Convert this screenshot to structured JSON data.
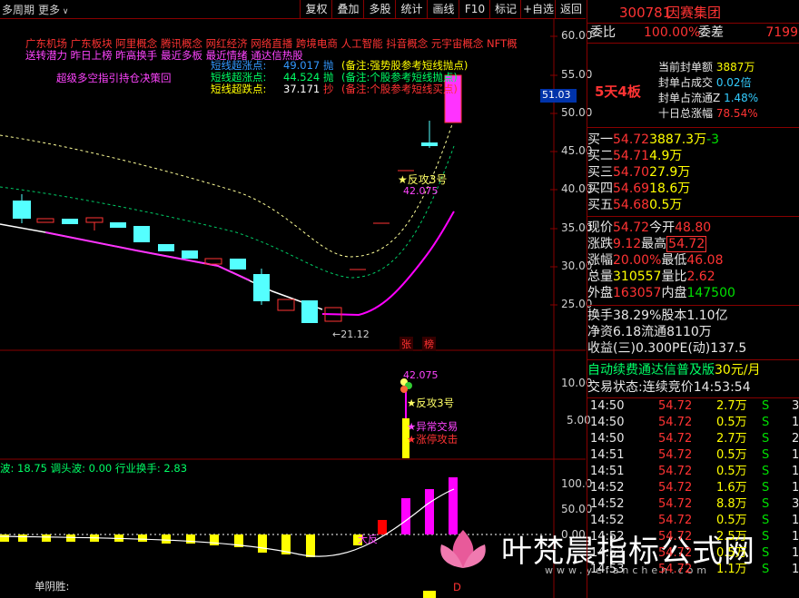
{
  "toolbar": {
    "period": "多周期",
    "more": "更多",
    "buttons": [
      "复权",
      "叠加",
      "多股",
      "统计",
      "画线",
      "F10",
      "标记",
      "+自选",
      "返回"
    ]
  },
  "chart": {
    "y_axis": [
      "60.00",
      "55.00",
      "50.00",
      "45.00",
      "40.00",
      "35.00",
      "30.00",
      "25.00"
    ],
    "price_tag": "51.03",
    "concepts_line1": "广东机场 广东板块 阿里概念 腾讯概念 网红经济 网络直播 跨境电商 人工智能 抖音概念 元宇宙概念 NFT概",
    "concepts_line2": "送转潜力 昨日上榜 昨高换手 最近多板 最近情绪 通达信热股",
    "strategy_label": "超级多空指引持仓决策回",
    "legend_rows": [
      {
        "name": "短线超涨点:",
        "value": "49.017",
        "action": "抛",
        "note": "(备注:强势股参考短线抛点)"
      },
      {
        "name": "短线超涨点:",
        "value": "44.524",
        "action": "抛",
        "note": "(备注:个股参考短线抛点)"
      },
      {
        "name": "短线超跌点:",
        "value": "37.171",
        "action": "抄",
        "note": "(备注:个股参考短线买点)"
      }
    ],
    "fangong_label": "★反攻3号",
    "fangong_value": "42.075",
    "low_label": "←21.12",
    "tag_zhang": "张",
    "tag_bang": "榜"
  },
  "sub1": {
    "y_axis": [
      "10.00",
      "5.00"
    ],
    "value_label": "42.075",
    "markers": [
      "★反攻3号",
      "★异常交易",
      "★涨停攻击"
    ]
  },
  "sub2": {
    "indicator_text": "波: 18.75  调头波: 0.00  行业换手: 2.83",
    "y_axis": [
      "100.0",
      "50.00",
      "0.00"
    ],
    "arrow_label": "大反",
    "bottom_label": "单阴胜:",
    "d_label": "D"
  },
  "watermark": {
    "title": "叶梵晨指标公式网",
    "url": "www.yefanchen.com"
  },
  "right": {
    "code": "300781",
    "name": "因赛集团",
    "weibi_label": "委比",
    "weibi_value": "100.00%",
    "weicha_label": "委差",
    "weicha_value": "7199",
    "board_tag": "5天4板",
    "seal_rows": [
      {
        "label": "当前封单额",
        "value": "3887万"
      },
      {
        "label": "封单占成交",
        "value": "0.02倍"
      },
      {
        "label": "封单占流通Z",
        "value": "1.48%"
      },
      {
        "label": "十日总涨幅",
        "value": "78.54%"
      }
    ],
    "bids": [
      {
        "label": "买一",
        "price": "54.72",
        "vol": "3887.3万",
        "ext": "-3"
      },
      {
        "label": "买二",
        "price": "54.71",
        "vol": "4.9万",
        "ext": ""
      },
      {
        "label": "买三",
        "price": "54.70",
        "vol": "27.9万",
        "ext": ""
      },
      {
        "label": "买四",
        "price": "54.69",
        "vol": "18.6万",
        "ext": ""
      },
      {
        "label": "买五",
        "price": "54.68",
        "vol": "0.5万",
        "ext": ""
      }
    ],
    "quote": [
      {
        "l1": "现价",
        "v1": "54.72",
        "l2": "今开",
        "v2": "48.80"
      },
      {
        "l1": "涨跌",
        "v1": "9.12",
        "l2": "最高",
        "v2": "54.72"
      },
      {
        "l1": "涨幅",
        "v1": "20.00%",
        "l2": "最低",
        "v2": "46.08"
      },
      {
        "l1": "总量",
        "v1": "310557",
        "l2": "量比",
        "v2": "2.62"
      },
      {
        "l1": "外盘",
        "v1": "163057",
        "l2": "内盘",
        "v2": "147500"
      }
    ],
    "stats": [
      {
        "l1": "换手",
        "v1": "38.29%",
        "l2": "股本",
        "v2": "1.10亿"
      },
      {
        "l1": "净资",
        "v1": "6.18",
        "l2": "流通",
        "v2": "8110万"
      },
      {
        "l1": "收益(三)",
        "v1": "0.300",
        "l2": "PE(动)",
        "v2": "137.5"
      }
    ],
    "promo": "自动续费通达信普及版",
    "promo_price": "30元/月",
    "status_label": "交易状态:",
    "status_value": "连续竞价",
    "status_time": "14:53:54",
    "ticks": [
      {
        "time": "14:50",
        "price": "54.72",
        "vol": "2.7万",
        "side": "S",
        "n": "3"
      },
      {
        "time": "14:50",
        "price": "54.72",
        "vol": "0.5万",
        "side": "S",
        "n": "1"
      },
      {
        "time": "14:50",
        "price": "54.72",
        "vol": "2.7万",
        "side": "S",
        "n": "2"
      },
      {
        "time": "14:51",
        "price": "54.72",
        "vol": "0.5万",
        "side": "S",
        "n": "1"
      },
      {
        "time": "14:51",
        "price": "54.72",
        "vol": "0.5万",
        "side": "S",
        "n": "1"
      },
      {
        "time": "14:52",
        "price": "54.72",
        "vol": "1.6万",
        "side": "S",
        "n": "1"
      },
      {
        "time": "14:52",
        "price": "54.72",
        "vol": "8.8万",
        "side": "S",
        "n": "3"
      },
      {
        "time": "14:52",
        "price": "54.72",
        "vol": "0.5万",
        "side": "S",
        "n": "1"
      },
      {
        "time": "14:52",
        "price": "54.72",
        "vol": "2.5万",
        "side": "S",
        "n": "1"
      },
      {
        "time": "14:53",
        "price": "54.72",
        "vol": "0.5万",
        "side": "S",
        "n": "1"
      },
      {
        "time": "14:53",
        "price": "54.72",
        "vol": "1.1万",
        "side": "S",
        "n": "1"
      }
    ]
  }
}
